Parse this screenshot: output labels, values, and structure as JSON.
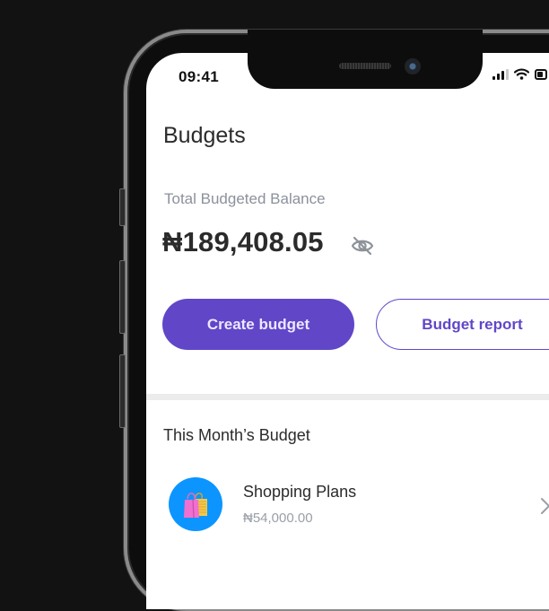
{
  "status_bar": {
    "time": "09:41",
    "icons": [
      "cellular-signal-icon",
      "wifi-icon",
      "battery-icon"
    ]
  },
  "header": {
    "title": "Budgets"
  },
  "balance": {
    "label": "Total Budgeted Balance",
    "amount": "₦189,408.05",
    "visibility_icon": "eye-off-icon"
  },
  "actions": {
    "create_label": "Create budget",
    "report_label": "Budget report"
  },
  "colors": {
    "accent": "#6146c8",
    "icon_bg": "#0c95ff",
    "muted_text": "#8b919b",
    "primary_text": "#2b2b2b",
    "divider": "#ececec"
  },
  "month_section": {
    "title": "This Month’s Budget",
    "items": [
      {
        "name": "Shopping Plans",
        "amount": "₦54,000.00",
        "icon": "shopping-bags-icon"
      }
    ]
  }
}
